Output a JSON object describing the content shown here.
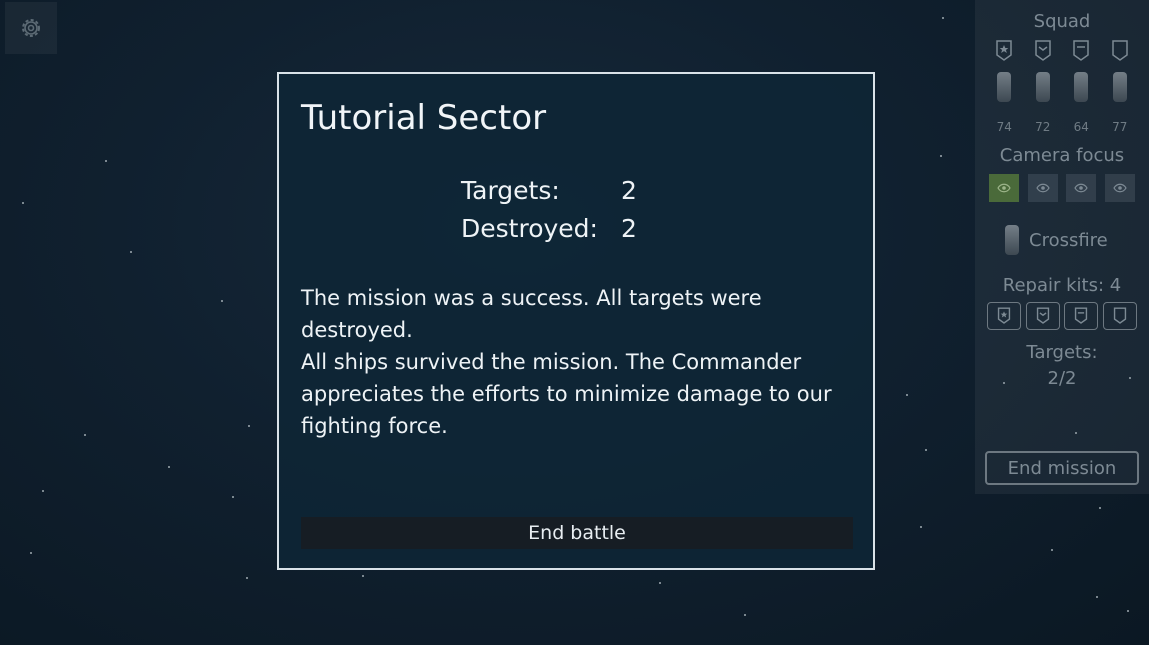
{
  "settings": {
    "icon": "gear-icon"
  },
  "dialog": {
    "title": "Tutorial Sector",
    "stats": [
      {
        "label": "Targets:",
        "value": "2"
      },
      {
        "label": "Destroyed:",
        "value": "2"
      }
    ],
    "message_1": "The mission was a success. All targets were destroyed.",
    "message_2": "All ships survived the mission. The Commander appreciates the efforts to minimize damage to our fighting force.",
    "end_battle_label": "End battle"
  },
  "side_panel": {
    "squad_title": "Squad",
    "squad_icons": [
      "star-badge-icon",
      "chevron-badge-icon",
      "bar-badge-icon",
      "shield-badge-icon"
    ],
    "ship_hp": [
      "74",
      "72",
      "64",
      "77"
    ],
    "camera_focus_title": "Camera focus",
    "camera_icons": [
      "eye-icon",
      "eye-icon",
      "eye-icon",
      "eye-icon"
    ],
    "crossfire_label": "Crossfire",
    "repair_kits_label": "Repair kits: 4",
    "targets_label": "Targets:",
    "targets_value": "2/2",
    "end_mission_label": "End mission"
  },
  "colors": {
    "accent_active": "#4a6a3a",
    "panel_text": "#7d8a94",
    "dialog_border": "#d9e2e8"
  }
}
